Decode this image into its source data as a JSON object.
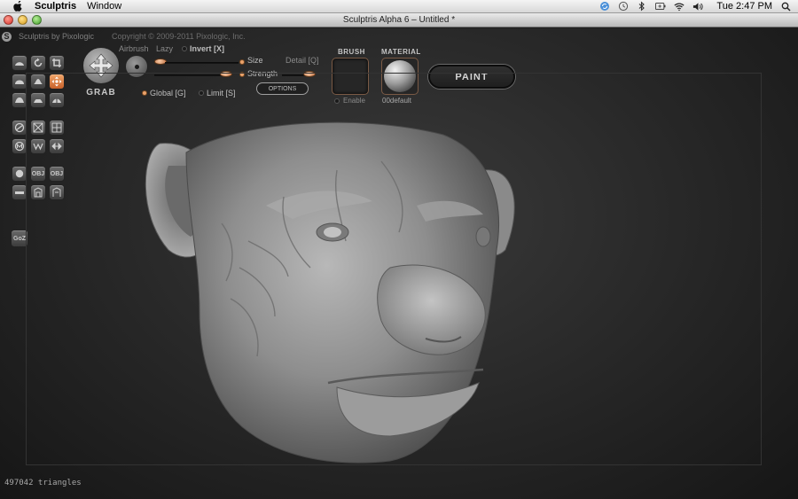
{
  "menubar": {
    "apple_icon": "apple-logo-icon",
    "app_name": "Sculptris",
    "menu_window": "Window",
    "status_icons": [
      "sync-icon",
      "time-machine-icon",
      "bluetooth-icon",
      "battery-icon",
      "wifi-icon",
      "volume-icon"
    ],
    "clock": "Tue 2:47 PM",
    "spotlight_icon": "search-icon"
  },
  "window": {
    "title": "Sculptris Alpha 6 – Untitled *"
  },
  "brand": {
    "name": "Sculptris by Pixologic",
    "copyright": "Copyright © 2009-2011 Pixologic, Inc."
  },
  "tool": {
    "name": "GRAB",
    "airbrush": "Airbrush",
    "lazy": "Lazy",
    "invert": "Invert [X]",
    "size": "Size",
    "strength": "Strength",
    "detail": "Detail [Q]",
    "global": "Global [G]",
    "limit": "Limit [S]",
    "options": "OPTIONS"
  },
  "brush": {
    "header": "BRUSH",
    "enable": "Enable"
  },
  "material": {
    "header": "MATERIAL",
    "name": "00default"
  },
  "paint_button": "PAINT",
  "palette": {
    "goz": "GoZ",
    "obj_in": "OBJ",
    "obj_out": "OBJ"
  },
  "status": {
    "triangles": "497042 triangles"
  },
  "colors": {
    "accent": "#e07a3a",
    "knob": "#e9a26b",
    "background": "#262626"
  }
}
